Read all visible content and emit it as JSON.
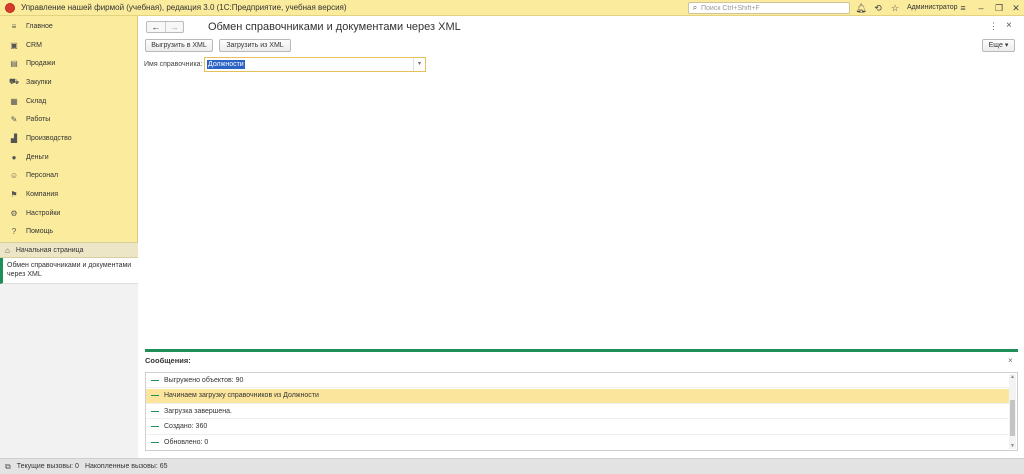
{
  "titlebar": {
    "title": "Управление нашей фирмой (учебная), редакция 3.0  (1С:Предприятие, учебная версия)",
    "search_placeholder": "Поиск Ctrl+Shift+F",
    "user": "Администратор",
    "icons": [
      "bell-icon",
      "history-icon",
      "star-icon",
      "menu-icon",
      "minimize-icon",
      "restore-icon",
      "close-icon"
    ]
  },
  "sidebar": {
    "items": [
      {
        "label": "Главное",
        "icon": "menu-icon"
      },
      {
        "label": "CRM",
        "icon": "crm-icon"
      },
      {
        "label": "Продажи",
        "icon": "sales-icon"
      },
      {
        "label": "Закупки",
        "icon": "cart-icon"
      },
      {
        "label": "Склад",
        "icon": "warehouse-icon"
      },
      {
        "label": "Работы",
        "icon": "wrench-icon"
      },
      {
        "label": "Производство",
        "icon": "factory-icon"
      },
      {
        "label": "Деньги",
        "icon": "money-icon"
      },
      {
        "label": "Персонал",
        "icon": "person-icon"
      },
      {
        "label": "Компания",
        "icon": "flag-icon"
      },
      {
        "label": "Настройки",
        "icon": "gear-icon"
      },
      {
        "label": "Помощь",
        "icon": "help-icon"
      }
    ],
    "home": "Начальная страница",
    "open_form": "Обмен справочниками и документами через XML"
  },
  "form": {
    "title": "Обмен справочниками и документами через XML",
    "export_button": "Выгрузить в XML",
    "import_button": "Загрузить из XML",
    "more_button": "Еще",
    "catalog_label": "Имя справочника:",
    "catalog_value": "Должности"
  },
  "messages": {
    "title": "Сообщения:",
    "rows": [
      "Выгружено объектов: 90",
      "Начинаем загрузку справочников из Должности",
      "Загрузка завершена.",
      "Создано: 360",
      "Обновлено: 0"
    ],
    "selected_index": 1
  },
  "statusbar": {
    "current_calls": "Текущие вызовы: 0",
    "accumulated_calls": "Накопленные вызовы: 65"
  },
  "colors": {
    "accent_yellow": "#fbeb9c",
    "accent_green": "#1f8f5a",
    "selection_blue": "#2b63c4"
  }
}
